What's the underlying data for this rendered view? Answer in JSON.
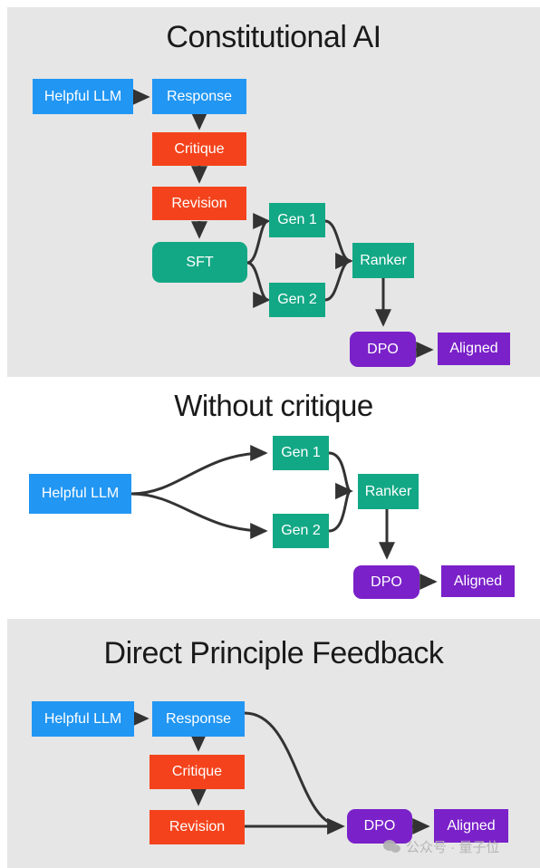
{
  "figure": {
    "type": "diagram",
    "description": "Three stacked flow diagrams comparing alignment training pipelines",
    "colors": {
      "blue": "#2196f3",
      "red": "#f4431c",
      "green": "#13a885",
      "purple": "#7a21c9",
      "panel_shaded": "#e6e6e6",
      "panel_plain": "#ffffff",
      "arrow": "#333333",
      "title_text": "#1a1a1a",
      "node_text": "#ffffff",
      "watermark": "#b3b3b3"
    }
  },
  "panels": [
    {
      "id": "constitutional-ai",
      "title": "Constitutional AI",
      "background": "shaded",
      "nodes": [
        {
          "id": "helpful-llm",
          "label": "Helpful LLM",
          "color": "blue",
          "shape": "rect"
        },
        {
          "id": "response",
          "label": "Response",
          "color": "blue",
          "shape": "rect"
        },
        {
          "id": "critique",
          "label": "Critique",
          "color": "red",
          "shape": "rect"
        },
        {
          "id": "revision",
          "label": "Revision",
          "color": "red",
          "shape": "rect"
        },
        {
          "id": "sft",
          "label": "SFT",
          "color": "green",
          "shape": "rounded"
        },
        {
          "id": "gen1",
          "label": "Gen 1",
          "color": "green",
          "shape": "rect"
        },
        {
          "id": "gen2",
          "label": "Gen 2",
          "color": "green",
          "shape": "rect"
        },
        {
          "id": "ranker",
          "label": "Ranker",
          "color": "green",
          "shape": "rect"
        },
        {
          "id": "dpo",
          "label": "DPO",
          "color": "purple",
          "shape": "rounded"
        },
        {
          "id": "aligned",
          "label": "Aligned",
          "color": "purple",
          "shape": "rect"
        }
      ],
      "edges": [
        {
          "from": "helpful-llm",
          "to": "response"
        },
        {
          "from": "response",
          "to": "critique"
        },
        {
          "from": "critique",
          "to": "revision"
        },
        {
          "from": "revision",
          "to": "sft"
        },
        {
          "from": "sft",
          "to": "gen1"
        },
        {
          "from": "sft",
          "to": "gen2"
        },
        {
          "from": "gen1",
          "to": "ranker"
        },
        {
          "from": "gen2",
          "to": "ranker"
        },
        {
          "from": "ranker",
          "to": "dpo"
        },
        {
          "from": "dpo",
          "to": "aligned"
        }
      ]
    },
    {
      "id": "without-critique",
      "title": "Without critique",
      "background": "plain",
      "nodes": [
        {
          "id": "helpful-llm",
          "label": "Helpful LLM",
          "color": "blue",
          "shape": "rect"
        },
        {
          "id": "gen1",
          "label": "Gen 1",
          "color": "green",
          "shape": "rect"
        },
        {
          "id": "gen2",
          "label": "Gen 2",
          "color": "green",
          "shape": "rect"
        },
        {
          "id": "ranker",
          "label": "Ranker",
          "color": "green",
          "shape": "rect"
        },
        {
          "id": "dpo",
          "label": "DPO",
          "color": "purple",
          "shape": "rounded"
        },
        {
          "id": "aligned",
          "label": "Aligned",
          "color": "purple",
          "shape": "rect"
        }
      ],
      "edges": [
        {
          "from": "helpful-llm",
          "to": "gen1"
        },
        {
          "from": "helpful-llm",
          "to": "gen2"
        },
        {
          "from": "gen1",
          "to": "ranker"
        },
        {
          "from": "gen2",
          "to": "ranker"
        },
        {
          "from": "ranker",
          "to": "dpo"
        },
        {
          "from": "dpo",
          "to": "aligned"
        }
      ]
    },
    {
      "id": "direct-principle-feedback",
      "title": "Direct Principle Feedback",
      "background": "shaded",
      "nodes": [
        {
          "id": "helpful-llm",
          "label": "Helpful LLM",
          "color": "blue",
          "shape": "rect"
        },
        {
          "id": "response",
          "label": "Response",
          "color": "blue",
          "shape": "rect"
        },
        {
          "id": "critique",
          "label": "Critique",
          "color": "red",
          "shape": "rect"
        },
        {
          "id": "revision",
          "label": "Revision",
          "color": "red",
          "shape": "rect"
        },
        {
          "id": "dpo",
          "label": "DPO",
          "color": "purple",
          "shape": "rounded"
        },
        {
          "id": "aligned",
          "label": "Aligned",
          "color": "purple",
          "shape": "rect"
        }
      ],
      "edges": [
        {
          "from": "helpful-llm",
          "to": "response"
        },
        {
          "from": "response",
          "to": "critique"
        },
        {
          "from": "critique",
          "to": "revision"
        },
        {
          "from": "response",
          "to": "dpo"
        },
        {
          "from": "revision",
          "to": "dpo"
        },
        {
          "from": "dpo",
          "to": "aligned"
        }
      ]
    }
  ],
  "watermark": {
    "icon": "wechat-icon",
    "text": "公众号 · 量子位"
  }
}
